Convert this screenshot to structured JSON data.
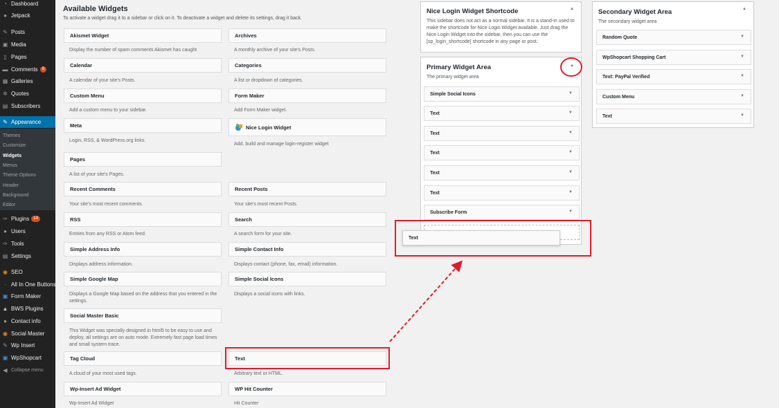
{
  "colors": {
    "sidebar_bg": "#222222",
    "active": "#0073aa",
    "highlight": "#e01a2b",
    "badge": "#d54e21"
  },
  "menu": {
    "dashboard": "Dashboard",
    "jetpack": "Jetpack",
    "posts": "Posts",
    "media": "Media",
    "pages": "Pages",
    "comments": "Comments",
    "comments_badge": "8",
    "galleries": "Galleries",
    "quotes": "Quotes",
    "subscribers": "Subscribers",
    "appearance": "Appearance",
    "sub": [
      "Themes",
      "Customize",
      "Widgets",
      "Menus",
      "Theme Options",
      "Header",
      "Background",
      "Editor"
    ],
    "plugins": "Plugins",
    "plugins_badge": "14",
    "users": "Users",
    "tools": "Tools",
    "settings": "Settings",
    "seo": "SEO",
    "all_in_one": "All In One Buttons",
    "form_maker": "Form Maker",
    "bws": "BWS Plugins",
    "contact": "Contact info",
    "social_master": "Social Master",
    "wp_insert": "Wp Insert",
    "wpshopcart": "WpShopcart",
    "collapse": "Collapse menu"
  },
  "available": {
    "title": "Available Widgets",
    "desc": "To activate a widget drag it to a sidebar or click on it. To deactivate a widget and delete its settings, drag it back.",
    "widgets": [
      {
        "name": "Akismet Widget",
        "desc": "Display the number of spam comments Akismet has caught"
      },
      {
        "name": "Archives",
        "desc": "A monthly archive of your site's Posts."
      },
      {
        "name": "Calendar",
        "desc": "A calendar of your site's Posts."
      },
      {
        "name": "Categories",
        "desc": "A list or dropdown of categories."
      },
      {
        "name": "Custom Menu",
        "desc": "Add a custom menu to your sidebar."
      },
      {
        "name": "Form Maker",
        "desc": "Add Form Maker widget."
      },
      {
        "name": "Meta",
        "desc": "Login, RSS, & WordPress.org links."
      },
      {
        "name": "Nice Login Widget",
        "desc": "Add, build and manage login-register widget"
      },
      {
        "name": "Pages",
        "desc": "A list of your site's Pages."
      },
      {
        "name": "Recent Comments",
        "desc": "Your site's most recent comments."
      },
      {
        "name": "Recent Posts",
        "desc": "Your site's most recent Posts."
      },
      {
        "name": "RSS",
        "desc": "Entries from any RSS or Atom feed."
      },
      {
        "name": "Search",
        "desc": "A search form for your site."
      },
      {
        "name": "Simple Address Info",
        "desc": "Displays address information."
      },
      {
        "name": "Simple Contact Info",
        "desc": "Displays contact (phone, fax, email) information."
      },
      {
        "name": "Simple Google Map",
        "desc": "Displays a Google Map based on the address that you entered in the settings."
      },
      {
        "name": "Simple Social Icons",
        "desc": "Displays a social icons with links."
      },
      {
        "name": "Social Master Basic",
        "desc": "This Widget was specially designed in html5 to be easy to use and deploy, all settings are on auto mode. Extremely fast page load times and small system trace."
      },
      {
        "name": "Tag Cloud",
        "desc": "A cloud of your most used tags."
      },
      {
        "name": "Text",
        "desc": "Arbitrary text or HTML."
      },
      {
        "name": "Wp-Insert Ad Widget",
        "desc": "Wp-Insert Ad Widget"
      },
      {
        "name": "WP Hit Counter",
        "desc": "Hit Counter"
      }
    ]
  },
  "nice_login": {
    "title": "Nice Login Widget Shortcode",
    "desc": "This sidebar does not act as a normal sidebar. It is a stand-in used to make the shortcode for Nice Login Widget available. Just drag the Nice Login Widget into the sidebar, then you can use the [sp_login_shortcode] shortcode in any page or post."
  },
  "primary": {
    "title": "Primary Widget Area",
    "desc": "The primary widget area",
    "items": [
      "Simple Social Icons",
      "Text",
      "Text",
      "Text",
      "Text",
      "Text",
      "Subscribe Form"
    ],
    "dragging": "Text"
  },
  "secondary": {
    "title": "Secondary Widget Area",
    "desc": "The secondary widget area",
    "items": [
      "Random Quote",
      "WpShopcart Shopping Cart",
      "Text: PayPal Verified",
      "Custom Menu",
      "Text"
    ]
  }
}
